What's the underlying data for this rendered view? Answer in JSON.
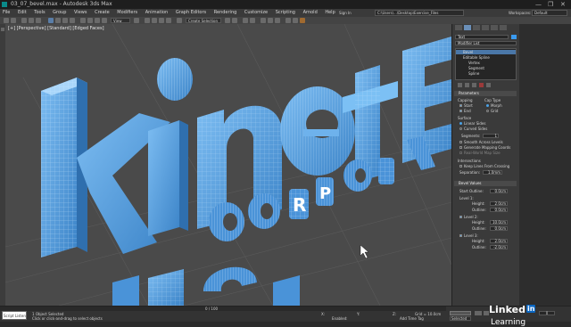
{
  "app": {
    "title": "03_07_bevel.max - Autodesk 3ds Max",
    "window_controls": [
      "—",
      "❐",
      "✕"
    ]
  },
  "menubar": {
    "items": [
      "File",
      "Edit",
      "Tools",
      "Group",
      "Views",
      "Create",
      "Modifiers",
      "Animation",
      "Graph Editors",
      "Rendering",
      "Customize",
      "Scripting",
      "Arnold",
      "Help"
    ],
    "sign_in": "Sign In",
    "path": "C:\\Users\\...\\Desktop\\Exercise_Files",
    "workspaces_label": "Workspaces:",
    "workspace_value": "Default"
  },
  "toolbar": {
    "view_dropdown": "View",
    "selection_set": "Create Selection Se"
  },
  "viewport": {
    "label": "[+] [Perspective] [Standard] [Edged Faces]",
    "text_top": "kinetE",
    "text_mid": "CORPORA",
    "text_bottom": "NC",
    "background": "#4a4a4a",
    "object_color": "#5ba4e6",
    "wire_color": "#cfe9ff"
  },
  "command_panel": {
    "object_name": "Text",
    "modifier_list": "Modifier List",
    "stack": [
      "Bevel",
      "Editable Spline",
      "Vertex",
      "Segment",
      "Spline"
    ],
    "parameters": {
      "header": "Parameters",
      "capping_label": "Capping",
      "cap_type_label": "Cap Type",
      "start": "Start",
      "end": "End",
      "morph": "Morph",
      "grid": "Grid",
      "surface_label": "Surface",
      "linear_sides": "Linear Sides",
      "curved_sides": "Curved Sides",
      "segments_label": "Segments:",
      "segments_value": "1",
      "smooth_across": "Smooth Across Levels",
      "gen_mapping": "Generate Mapping Coords",
      "real_world": "Real-World Map Size",
      "intersections_label": "Intersections",
      "keep_lines": "Keep Lines From Crossing",
      "separation_label": "Separation:",
      "separation_value": "1.0mm"
    },
    "bevel_values": {
      "header": "Bevel Values",
      "start_outline_label": "Start Outline:",
      "start_outline_value": "0.0cm",
      "level1_label": "Level 1:",
      "level1_height_label": "Height:",
      "level1_height_value": "2.0cm",
      "level1_outline_label": "Outline:",
      "level1_outline_value": "0.0cm",
      "level2_label": "Level 2:",
      "level2_height_label": "Height:",
      "level2_height_value": "10.0cm",
      "level2_outline_label": "Outline:",
      "level2_outline_value": "0.0cm",
      "level3_label": "Level 3:",
      "level3_height_label": "Height:",
      "level3_height_value": "2.0cm",
      "level3_outline_label": "Outline:",
      "level3_outline_value": "-2.0cm"
    }
  },
  "statusbar": {
    "timeline_frame": "0 / 100",
    "script_box": "Script Listener",
    "status_main": "1 Object Selected",
    "status_hint": "Click or click-and-drag to select objects",
    "x_label": "X:",
    "y_label": "Y:",
    "z_label": "Z:",
    "grid_label": "Grid = 10.0cm",
    "time_tag": "Add Time Tag",
    "enabled_label": "Enabled:",
    "selected_label": "Selected",
    "frame_value": "0"
  },
  "watermark": {
    "brand": "Linked",
    "brand_box": "in",
    "suffix": "Learning"
  }
}
